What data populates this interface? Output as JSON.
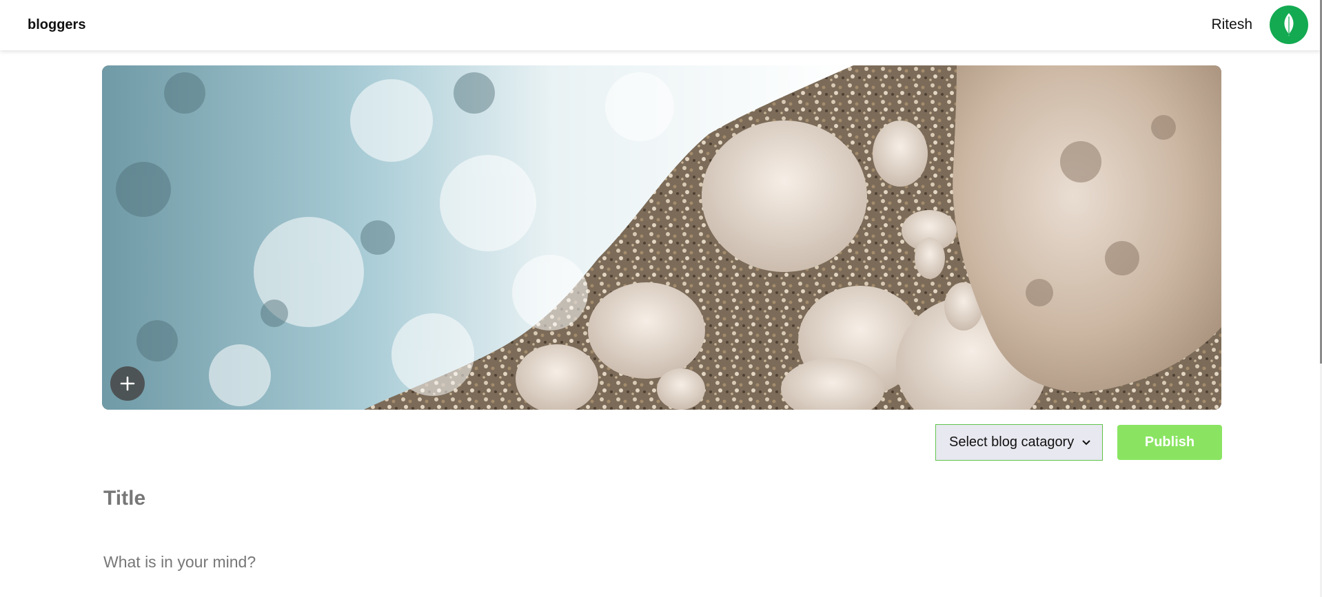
{
  "header": {
    "brand": "bloggers",
    "username": "Ritesh",
    "avatar_icon": "leaf-icon",
    "avatar_color": "#13aa52"
  },
  "banner": {
    "image_subject": "sea foam over pebbles and rocks",
    "upload_icon": "plus-icon"
  },
  "editor": {
    "category_select": {
      "selected": "Select blog catagory",
      "icon": "chevron-down-icon"
    },
    "publish_label": "Publish",
    "publish_color": "#8ae462",
    "title_placeholder": "Title",
    "body_placeholder": "What is in your mind?"
  }
}
